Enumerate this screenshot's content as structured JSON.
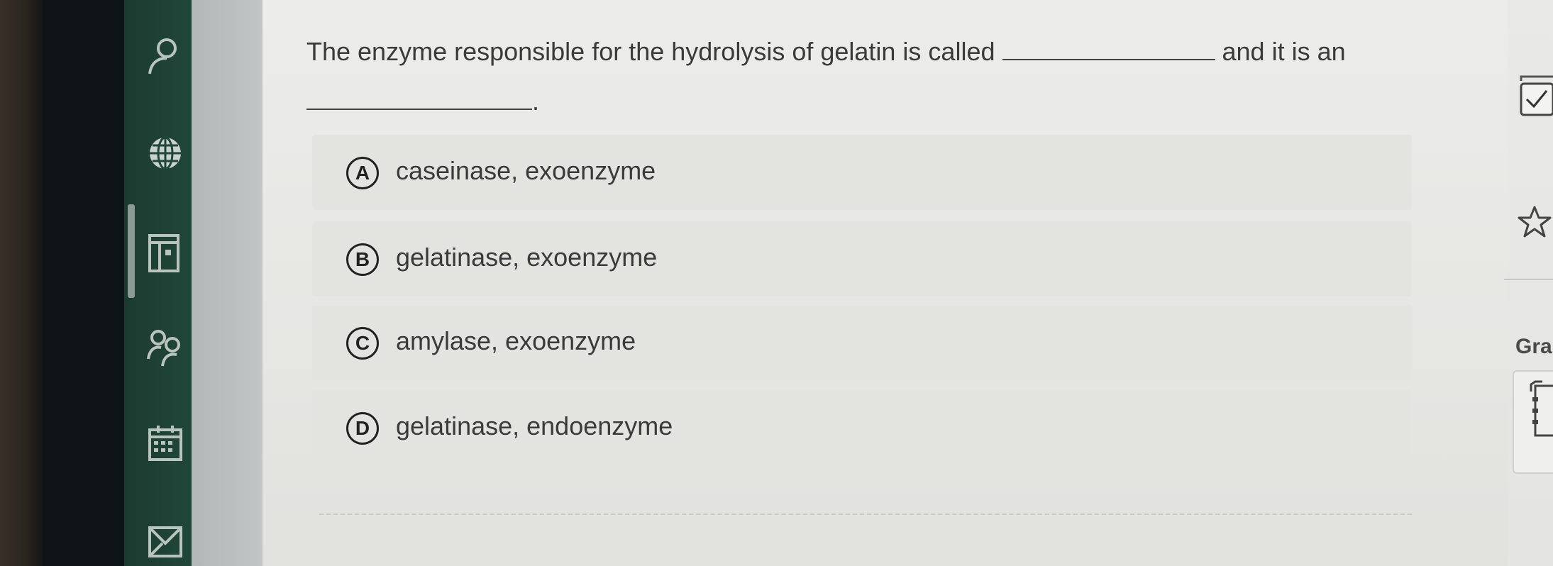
{
  "question": {
    "part1": "The enzyme responsible for the hydrolysis of gelatin is called",
    "part2": "and it is an",
    "part3": "."
  },
  "options": [
    {
      "letter": "A",
      "text": "caseinase, exoenzyme"
    },
    {
      "letter": "B",
      "text": "gelatinase, exoenzyme"
    },
    {
      "letter": "C",
      "text": "amylase, exoenzyme"
    },
    {
      "letter": "D",
      "text": "gelatinase, endoenzyme"
    }
  ],
  "sidebar": {
    "icons": [
      "person-icon",
      "globe-icon",
      "book-icon",
      "people-icon",
      "calendar-icon",
      "mail-icon"
    ]
  },
  "right_toolbar": {
    "icons": [
      "checkbox-icon",
      "star-icon",
      "notes-icon"
    ],
    "grade_label": "Gra"
  },
  "colors": {
    "rail": "#21473a",
    "panel": "#ececea",
    "option_bg": "#e3e3e0",
    "text": "#3a3a3a"
  }
}
